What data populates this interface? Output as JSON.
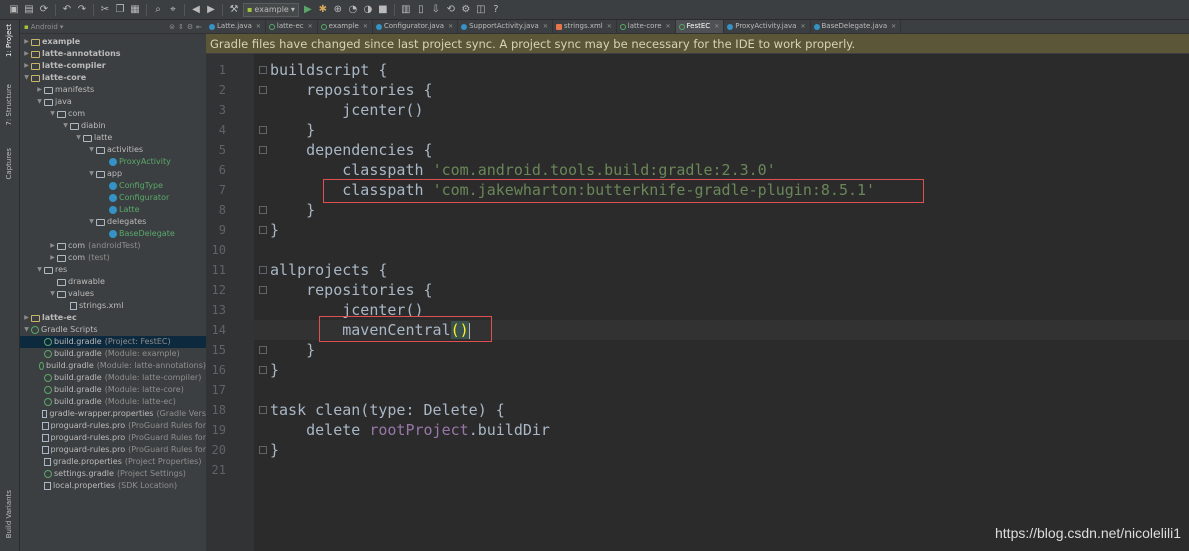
{
  "toolbar": {
    "run_config": "example"
  },
  "left_stripe": {
    "items": [
      "1: Project",
      "7: Structure",
      "Captures",
      "Build Variants"
    ]
  },
  "project_panel": {
    "view": "Android",
    "tree": [
      {
        "label": "example",
        "depth": 0,
        "arrow": "right",
        "icon": "folder-module",
        "bold": true
      },
      {
        "label": "latte-annotations",
        "depth": 0,
        "arrow": "right",
        "icon": "folder-module",
        "bold": true
      },
      {
        "label": "latte-compiler",
        "depth": 0,
        "arrow": "right",
        "icon": "folder-module",
        "bold": true
      },
      {
        "label": "latte-core",
        "depth": 0,
        "arrow": "down",
        "icon": "folder-module",
        "bold": true
      },
      {
        "label": "manifests",
        "depth": 1,
        "arrow": "right",
        "icon": "folder"
      },
      {
        "label": "java",
        "depth": 1,
        "arrow": "down",
        "icon": "folder"
      },
      {
        "label": "com",
        "depth": 2,
        "arrow": "down",
        "icon": "folder"
      },
      {
        "label": "diabin",
        "depth": 3,
        "arrow": "down",
        "icon": "folder"
      },
      {
        "label": "latte",
        "depth": 4,
        "arrow": "down",
        "icon": "folder"
      },
      {
        "label": "activities",
        "depth": 5,
        "arrow": "down",
        "icon": "folder"
      },
      {
        "label": "ProxyActivity",
        "depth": 6,
        "arrow": "none",
        "icon": "class",
        "kind": "class"
      },
      {
        "label": "app",
        "depth": 5,
        "arrow": "down",
        "icon": "folder"
      },
      {
        "label": "ConfigType",
        "depth": 6,
        "arrow": "none",
        "icon": "class",
        "kind": "class"
      },
      {
        "label": "Configurator",
        "depth": 6,
        "arrow": "none",
        "icon": "class",
        "kind": "class"
      },
      {
        "label": "Latte",
        "depth": 6,
        "arrow": "none",
        "icon": "class",
        "kind": "class"
      },
      {
        "label": "delegates",
        "depth": 5,
        "arrow": "down",
        "icon": "folder"
      },
      {
        "label": "BaseDelegate",
        "depth": 6,
        "arrow": "none",
        "icon": "class",
        "kind": "class"
      },
      {
        "label": "com",
        "hint": "(androidTest)",
        "depth": 2,
        "arrow": "right",
        "icon": "folder"
      },
      {
        "label": "com",
        "hint": "(test)",
        "depth": 2,
        "arrow": "right",
        "icon": "folder"
      },
      {
        "label": "res",
        "depth": 1,
        "arrow": "down",
        "icon": "folder"
      },
      {
        "label": "drawable",
        "depth": 2,
        "arrow": "none",
        "icon": "folder"
      },
      {
        "label": "values",
        "depth": 2,
        "arrow": "down",
        "icon": "folder"
      },
      {
        "label": "strings.xml",
        "depth": 3,
        "arrow": "none",
        "icon": "file"
      },
      {
        "label": "latte-ec",
        "depth": 0,
        "arrow": "right",
        "icon": "folder-module",
        "bold": true
      },
      {
        "label": "Gradle Scripts",
        "depth": 0,
        "arrow": "down",
        "icon": "gradle"
      },
      {
        "label": "build.gradle",
        "hint": "(Project: FestEC)",
        "depth": 1,
        "arrow": "none",
        "icon": "gradle",
        "selected": true
      },
      {
        "label": "build.gradle",
        "hint": "(Module: example)",
        "depth": 1,
        "arrow": "none",
        "icon": "gradle"
      },
      {
        "label": "build.gradle",
        "hint": "(Module: latte-annotations)",
        "depth": 1,
        "arrow": "none",
        "icon": "gradle"
      },
      {
        "label": "build.gradle",
        "hint": "(Module: latte-compiler)",
        "depth": 1,
        "arrow": "none",
        "icon": "gradle"
      },
      {
        "label": "build.gradle",
        "hint": "(Module: latte-core)",
        "depth": 1,
        "arrow": "none",
        "icon": "gradle"
      },
      {
        "label": "build.gradle",
        "hint": "(Module: latte-ec)",
        "depth": 1,
        "arrow": "none",
        "icon": "gradle"
      },
      {
        "label": "gradle-wrapper.properties",
        "hint": "(Gradle Vers",
        "depth": 1,
        "arrow": "none",
        "icon": "file"
      },
      {
        "label": "proguard-rules.pro",
        "hint": "(ProGuard Rules for",
        "depth": 1,
        "arrow": "none",
        "icon": "file"
      },
      {
        "label": "proguard-rules.pro",
        "hint": "(ProGuard Rules for",
        "depth": 1,
        "arrow": "none",
        "icon": "file"
      },
      {
        "label": "proguard-rules.pro",
        "hint": "(ProGuard Rules for",
        "depth": 1,
        "arrow": "none",
        "icon": "file"
      },
      {
        "label": "gradle.properties",
        "hint": "(Project Properties)",
        "depth": 1,
        "arrow": "none",
        "icon": "file"
      },
      {
        "label": "settings.gradle",
        "hint": "(Project Settings)",
        "depth": 1,
        "arrow": "none",
        "icon": "gradle"
      },
      {
        "label": "local.properties",
        "hint": "(SDK Location)",
        "depth": 1,
        "arrow": "none",
        "icon": "file"
      }
    ]
  },
  "tabs": [
    {
      "label": "Latte.java",
      "icon": "class"
    },
    {
      "label": "latte-ec",
      "icon": "gradle"
    },
    {
      "label": "example",
      "icon": "gradle"
    },
    {
      "label": "Configurator.java",
      "icon": "class"
    },
    {
      "label": "SupportActivity.java",
      "icon": "class"
    },
    {
      "label": "strings.xml",
      "icon": "xml"
    },
    {
      "label": "latte-core",
      "icon": "gradle"
    },
    {
      "label": "FestEC",
      "icon": "gradle",
      "active": true
    },
    {
      "label": "ProxyActivity.java",
      "icon": "class"
    },
    {
      "label": "BaseDelegate.java",
      "icon": "class"
    }
  ],
  "banner": {
    "text": "Gradle files have changed since last project sync. A project sync may be necessary for the IDE to work properly."
  },
  "code": {
    "line_numbers": [
      "1",
      "2",
      "3",
      "4",
      "5",
      "6",
      "7",
      "8",
      "9",
      "10",
      "11",
      "12",
      "13",
      "14",
      "15",
      "16",
      "17",
      "18",
      "19",
      "20",
      "21"
    ],
    "lines": [
      [
        {
          "t": "buildscript {",
          "c": ""
        }
      ],
      [
        {
          "t": "    repositories {",
          "c": ""
        }
      ],
      [
        {
          "t": "        jcenter()",
          "c": ""
        }
      ],
      [
        {
          "t": "    }",
          "c": ""
        }
      ],
      [
        {
          "t": "    dependencies {",
          "c": ""
        }
      ],
      [
        {
          "t": "        classpath ",
          "c": ""
        },
        {
          "t": "'com.android.tools.build:gradle:2.3.0'",
          "c": "str"
        }
      ],
      [
        {
          "t": "        classpath ",
          "c": ""
        },
        {
          "t": "'com.jakewharton:butterknife-gradle-plugin:8.5.1'",
          "c": "str"
        }
      ],
      [
        {
          "t": "    }",
          "c": ""
        }
      ],
      [
        {
          "t": "}",
          "c": ""
        }
      ],
      [],
      [
        {
          "t": "allprojects {",
          "c": ""
        }
      ],
      [
        {
          "t": "    repositories {",
          "c": ""
        }
      ],
      [
        {
          "t": "        jcenter()",
          "c": ""
        }
      ],
      [
        {
          "t": "        mavenCentral",
          "c": ""
        },
        {
          "t": "()",
          "c": "paren"
        }
      ],
      [
        {
          "t": "    }",
          "c": ""
        }
      ],
      [
        {
          "t": "}",
          "c": ""
        }
      ],
      [],
      [
        {
          "t": "task clean(",
          "c": ""
        },
        {
          "t": "type",
          "c": ""
        },
        {
          "t": ": Delete) {",
          "c": ""
        }
      ],
      [
        {
          "t": "    delete ",
          "c": ""
        },
        {
          "t": "rootProject",
          "c": "prop"
        },
        {
          "t": ".buildDir",
          "c": ""
        }
      ],
      [
        {
          "t": "}",
          "c": ""
        }
      ],
      []
    ],
    "current_line": 14
  },
  "watermark": "https://blog.csdn.net/nicolelili1"
}
